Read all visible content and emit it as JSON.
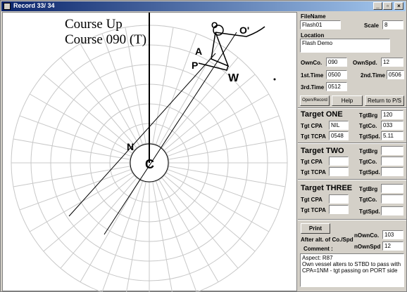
{
  "window": {
    "title": "Record  33/ 34",
    "buttons": {
      "minimize": "_",
      "restore": "▫",
      "close": "×"
    }
  },
  "radar": {
    "header_line1": "Course Up",
    "header_line2": "Course 090 (T)",
    "marks": {
      "c": "C",
      "n": "N",
      "p": "P",
      "a": "A",
      "w": "W",
      "o": "O",
      "o_prime": "O'"
    }
  },
  "panel": {
    "filename_label": "FileName",
    "filename_value": "Flash01",
    "scale_label": "Scale",
    "scale_value": "8",
    "location_label": "Location",
    "location_value": "Flash Demo",
    "ownco_label": "OwnCo.",
    "ownco_value": "090",
    "ownspd_label": "OwnSpd.",
    "ownspd_value": "12",
    "time1_label": "1st.Time",
    "time1_value": "0500",
    "time2_label": "2nd.Time",
    "time2_value": "0506",
    "time3_label": "3rd.Time",
    "time3_value": "0512",
    "buttons": {
      "open_record": "Open/Record",
      "help": "Help",
      "return": "Return to P/S"
    },
    "target_one": {
      "title": "Target ONE",
      "tgtbrg_label": "TgtBrg",
      "tgtbrg_value": "120",
      "tgtcpa_label": "Tgt CPA",
      "tgtcpa_value": "NIL",
      "tgtco_label": "TgtCo.",
      "tgtco_value": "033",
      "tgttcpa_label": "Tgt TCPA",
      "tgttcpa_value": "0548",
      "tgtspd_label": "TgtSpd.",
      "tgtspd_value": "5.11"
    },
    "target_two": {
      "title": "Target TWO",
      "tgtbrg_label": "TgtBrg",
      "tgtbrg_value": "",
      "tgtcpa_label": "Tgt CPA",
      "tgtcpa_value": "",
      "tgtco_label": "TgtCo.",
      "tgtco_value": "",
      "tgttcpa_label": "Tgt TCPA",
      "tgttcpa_value": "",
      "tgtspd_label": "TgtSpd.",
      "tgtspd_value": ""
    },
    "target_three": {
      "title": "Target THREE",
      "tgtbrg_label": "TgtBrg",
      "tgtbrg_value": "",
      "tgtcpa_label": "Tgt CPA",
      "tgtcpa_value": "",
      "tgtco_label": "TgtCo.",
      "tgtco_value": "",
      "tgttcpa_label": "Tgt TCPA",
      "tgttcpa_value": "",
      "tgtspd_label": "TgtSpd.",
      "tgtspd_value": ""
    },
    "print_label": "Print",
    "nownco_label": "nOwnCo.",
    "nownco_value": "103",
    "after_alt_label": "After alt. of Co./Spd",
    "nownspd_label": "nOwnSpd",
    "nownspd_value": "12",
    "comment_label": "Comment :",
    "comment_text": "Aspect: R87\nOwn vessel alters to STBD to pass with CPA=1NM - tgt passing on PORT side"
  }
}
